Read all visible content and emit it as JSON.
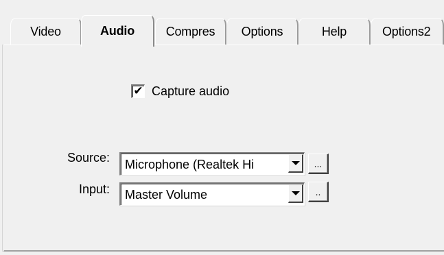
{
  "tabs": [
    {
      "label": "Video",
      "selected": false
    },
    {
      "label": "Audio",
      "selected": true
    },
    {
      "label": "Compres",
      "selected": false
    },
    {
      "label": "Options",
      "selected": false
    },
    {
      "label": "Help",
      "selected": false
    },
    {
      "label": "Options2",
      "selected": false
    }
  ],
  "capture_audio": {
    "label": "Capture audio",
    "checked": true,
    "check_glyph": "✔"
  },
  "source": {
    "label": "Source:",
    "value": "Microphone (Realtek Hi",
    "button_label": "..."
  },
  "input": {
    "label": "Input:",
    "value": "Master Volume",
    "button_label": ".."
  }
}
